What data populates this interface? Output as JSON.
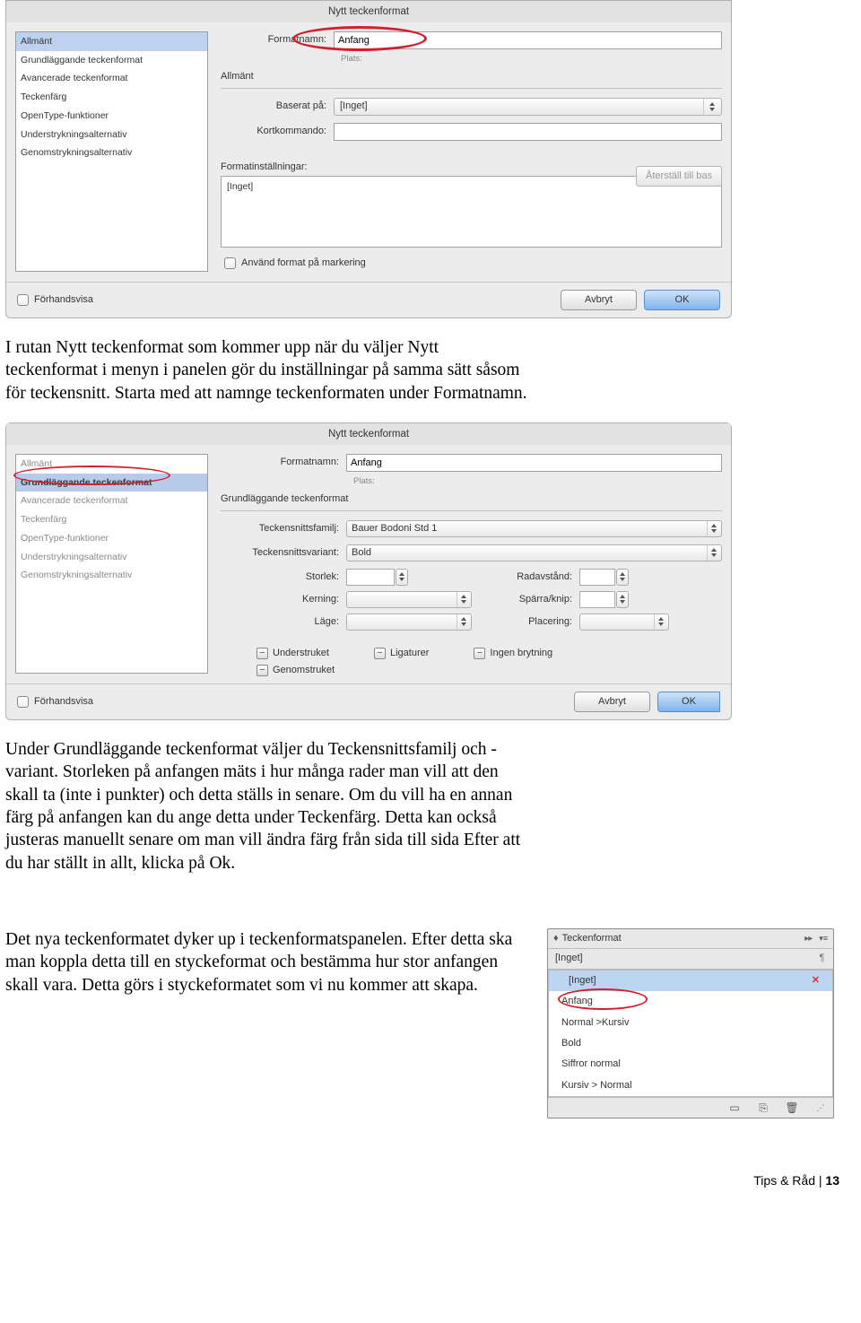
{
  "dialog1": {
    "title": "Nytt teckenformat",
    "side": [
      "Allmänt",
      "Grundläggande teckenformat",
      "Avancerade teckenformat",
      "Teckenfärg",
      "OpenType-funktioner",
      "Understrykningsalternativ",
      "Genomstrykningsalternativ"
    ],
    "formatnamn_label": "Formatnamn:",
    "formatnamn_value": "Anfang",
    "plats_label": "Plats:",
    "section": "Allmänt",
    "baserat_label": "Baserat på:",
    "baserat_value": "[Inget]",
    "kort_label": "Kortkommando:",
    "kort_value": "",
    "formatinst_label": "Formatinställningar:",
    "reset": "Återställ till bas",
    "settings_value": "[Inget]",
    "apply_label": "Använd format på markering",
    "preview": "Förhandsvisa",
    "cancel": "Avbryt",
    "ok": "OK"
  },
  "para1": "I rutan Nytt teckenformat som kommer upp när du väljer Nytt teckenformat i menyn i panelen gör du inställningar på samma sätt såsom för teckensnitt. Starta med att namnge teckenformaten under Formatnamn.",
  "dialog2": {
    "title": "Nytt teckenformat",
    "side": [
      "Allmänt",
      "Grundläggande teckenformat",
      "Avancerade teckenformat",
      "Teckenfärg",
      "OpenType-funktioner",
      "Understrykningsalternativ",
      "Genomstrykningsalternativ"
    ],
    "formatnamn_label": "Formatnamn:",
    "formatnamn_value": "Anfang",
    "plats_label": "Plats:",
    "section": "Grundläggande teckenformat",
    "familj_label": "Teckensnittsfamilj:",
    "familj_value": "Bauer Bodoni Std 1",
    "variant_label": "Teckensnittsvariant:",
    "variant_value": "Bold",
    "storlek_label": "Storlek:",
    "radavstand_label": "Radavstånd:",
    "kerning_label": "Kerning:",
    "sparra_label": "Spärra/knip:",
    "lage_label": "Läge:",
    "placering_label": "Placering:",
    "chk_under": "Understruket",
    "chk_lig": "Ligaturer",
    "chk_nobreak": "Ingen brytning",
    "chk_genom": "Genomstruket",
    "preview": "Förhandsvisa",
    "cancel": "Avbryt",
    "ok": "OK"
  },
  "para2": "Under Grundläggande teckenformat väljer du Teckensnittsfamilj och -variant. Storleken på anfangen mäts i hur många rader man vill att den skall ta (inte i punkter) och detta ställs in senare. Om du vill ha en annan färg på anfangen kan du ange detta under Teckenfärg. Detta kan också justeras manuellt senare om man vill ändra färg från sida till sida Efter att du har ställt in allt, klicka på Ok.",
  "para3": "Det nya teckenformatet dyker up i teckenformatspanelen. Efter detta ska man koppla detta till en styckeformat och bestämma hur stor anfangen skall vara. Detta görs i styckeformatet som vi nu kommer att skapa.",
  "panel": {
    "tab": "Teckenformat",
    "ingetTop": "[Inget]",
    "items": [
      "[Inget]",
      "Anfang",
      "Normal >Kursiv",
      "Bold",
      "Siffror normal",
      "Kursiv > Normal"
    ]
  },
  "footer_text": "Tips & Råd | ",
  "footer_page": "13"
}
